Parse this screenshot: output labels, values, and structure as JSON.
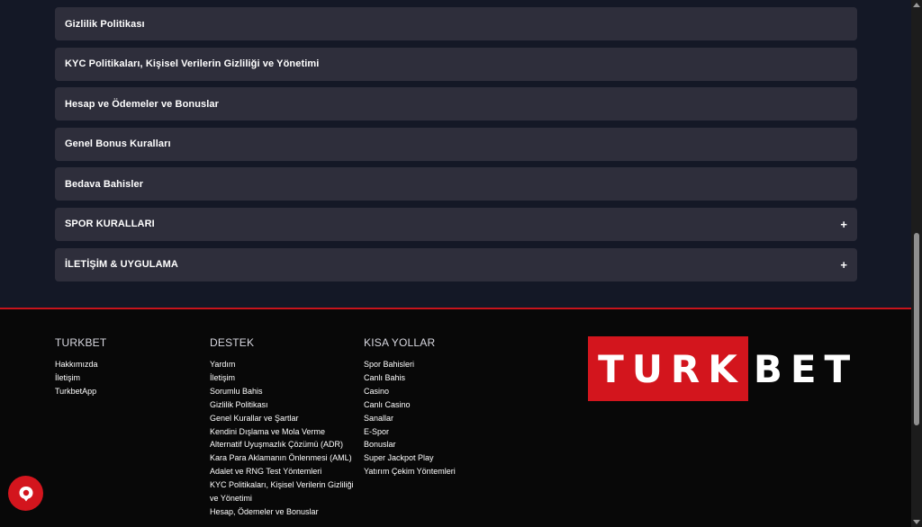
{
  "accordion": [
    {
      "label": "Gizlilik Politikası",
      "expandable": false
    },
    {
      "label": "KYC Politikaları, Kişisel Verilerin Gizliliği ve Yönetimi",
      "expandable": false
    },
    {
      "label": "Hesap ve Ödemeler ve Bonuslar",
      "expandable": false
    },
    {
      "label": "Genel Bonus Kuralları",
      "expandable": false
    },
    {
      "label": "Bedava Bahisler",
      "expandable": false
    },
    {
      "label": "SPOR KURALLARI",
      "expandable": true
    },
    {
      "label": "İLETİŞİM & UYGULAMA",
      "expandable": true
    }
  ],
  "plus_symbol": "+",
  "footer": {
    "turkbet": {
      "title": "TURKBET",
      "links": [
        "Hakkımızda",
        "İletişim",
        "TurkbetApp"
      ]
    },
    "destek": {
      "title": "DESTEK",
      "links": [
        "Yardım",
        "İletişim",
        "Sorumlu Bahis",
        "Gizlilik Politikası",
        "Genel Kurallar ve Şartlar",
        "Kendini Dışlama ve Mola Verme",
        "Alternatif Uyuşmazlık Çözümü (ADR)",
        "Kara Para Aklamanın Önlenmesi (AML)",
        "Adalet ve RNG Test Yöntemleri",
        "KYC Politikaları, Kişisel Verilerin Gizliliği ve Yönetimi",
        "Hesap, Ödemeler ve Bonuslar"
      ]
    },
    "kisa_yollar": {
      "title": "KISA YOLLAR",
      "links": [
        "Spor Bahisleri",
        "Canlı Bahis",
        "Casino",
        "Canlı Casino",
        "Sanallar",
        "E-Spor",
        "Bonuslar",
        "Super Jackpot Play",
        "Yatırım Çekim Yöntemleri"
      ]
    }
  },
  "logo": {
    "part1": "TURK",
    "part2": "BET",
    "brand_color": "#d3151d"
  },
  "chat": {
    "icon": "chat-bubble-icon"
  }
}
